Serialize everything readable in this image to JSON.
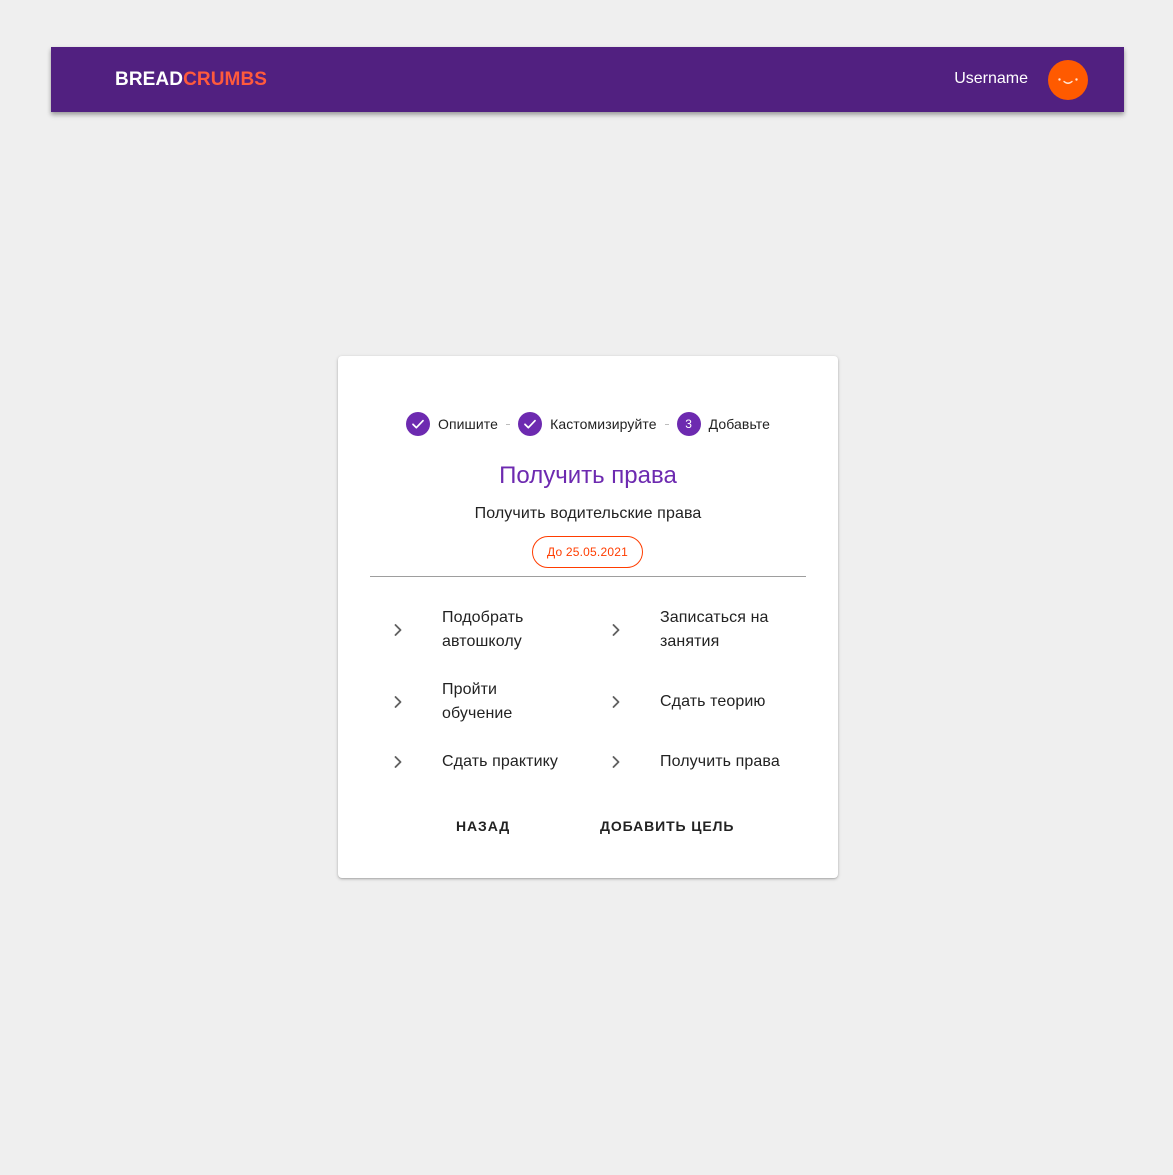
{
  "header": {
    "logo_part1": "BREAD",
    "logo_part2": "CRUMBS",
    "username": "Username",
    "avatar_icon": "smiley-face-icon"
  },
  "colors": {
    "appbar": "#512080",
    "accent_purple": "#6d2ab0",
    "accent_orange": "#ff5a00",
    "chip_orange": "#ff3d00",
    "background": "#efefef"
  },
  "stepper": {
    "steps": [
      {
        "label": "Опишите",
        "status": "completed",
        "icon": "check-icon"
      },
      {
        "label": "Кастомизируйте",
        "status": "completed",
        "icon": "check-icon"
      },
      {
        "label": "Добавьте",
        "status": "active",
        "number": "3"
      }
    ]
  },
  "goal": {
    "title": "Получить права",
    "description": "Получить водительские права",
    "deadline": "До 25.05.2021"
  },
  "tasks": [
    {
      "label": "Подобрать автошколу",
      "icon": "chevron-right-icon"
    },
    {
      "label": "Записаться на занятия",
      "icon": "chevron-right-icon"
    },
    {
      "label": "Пройти обучение",
      "icon": "chevron-right-icon"
    },
    {
      "label": "Сдать теорию",
      "icon": "chevron-right-icon"
    },
    {
      "label": "Сдать практику",
      "icon": "chevron-right-icon"
    },
    {
      "label": "Получить права",
      "icon": "chevron-right-icon"
    }
  ],
  "actions": {
    "back_label": "НАЗАД",
    "add_goal_label": "ДОБАВИТЬ ЦЕЛЬ"
  }
}
